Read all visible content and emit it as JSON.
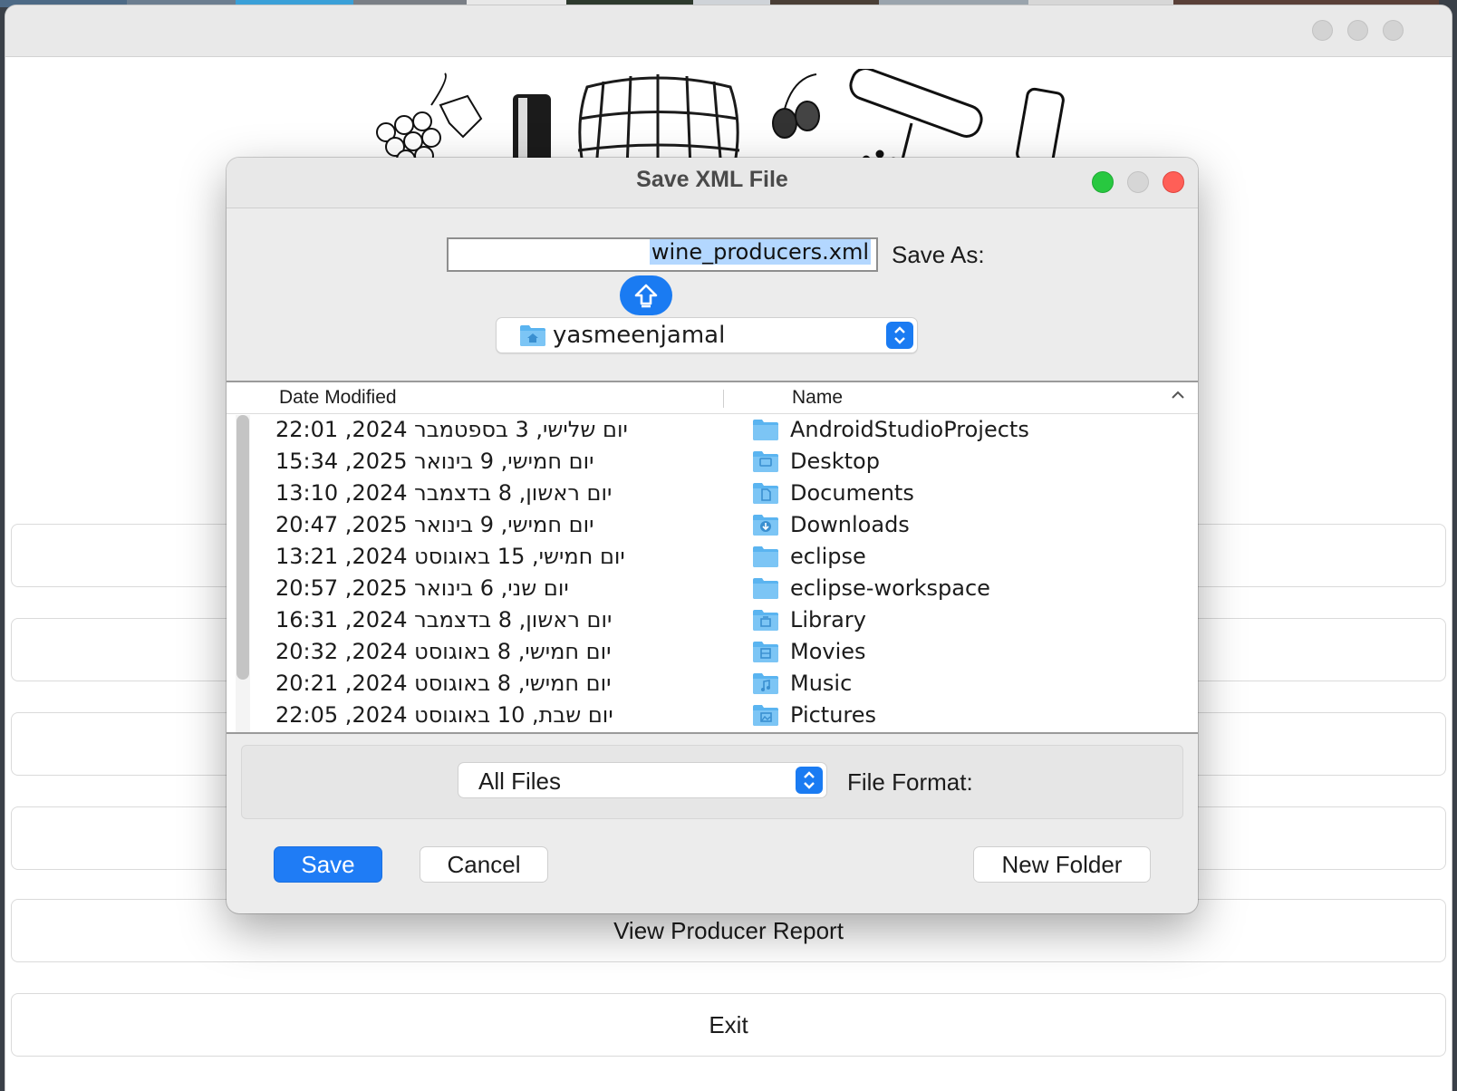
{
  "dialog": {
    "title": "Save XML File",
    "save_as_label": "Save As:",
    "filename_value": "wine_producers.xml",
    "location": "yasmeenjamal",
    "columns": {
      "date": "Date Modified",
      "name": "Name"
    },
    "files": [
      {
        "date": "יום שלישי, 3 בספטמבר 2024, 22:01",
        "name": "AndroidStudioProjects",
        "icon": "folder-icon"
      },
      {
        "date": "יום חמישי, 9 בינואר 2025, 15:34",
        "name": "Desktop",
        "icon": "desktop-folder-icon"
      },
      {
        "date": "יום ראשון, 8 בדצמבר 2024, 13:10",
        "name": "Documents",
        "icon": "documents-folder-icon"
      },
      {
        "date": "יום חמישי, 9 בינואר 2025, 20:47",
        "name": "Downloads",
        "icon": "downloads-folder-icon"
      },
      {
        "date": "יום חמישי, 15 באוגוסט 2024, 13:21",
        "name": "eclipse",
        "icon": "folder-icon"
      },
      {
        "date": "יום שני, 6 בינואר 2025, 20:57",
        "name": "eclipse-workspace",
        "icon": "folder-icon"
      },
      {
        "date": "יום ראשון, 8 בדצמבר 2024, 16:31",
        "name": "Library",
        "icon": "library-folder-icon"
      },
      {
        "date": "יום חמישי, 8 באוגוסט 2024, 20:32",
        "name": "Movies",
        "icon": "movies-folder-icon"
      },
      {
        "date": "יום חמישי, 8 באוגוסט 2024, 20:21",
        "name": "Music",
        "icon": "music-folder-icon"
      },
      {
        "date": "יום שבת, 10 באוגוסט 2024, 22:05",
        "name": "Pictures",
        "icon": "pictures-folder-icon"
      }
    ],
    "file_format_label": "File Format:",
    "file_format_value": "All Files",
    "buttons": {
      "save": "Save",
      "cancel": "Cancel",
      "new_folder": "New Folder"
    }
  },
  "main_window": {
    "buttons": [
      "View Producer Report",
      "Exit"
    ]
  },
  "colors": {
    "accent": "#1f7cf5",
    "close": "#ff5f57",
    "zoom": "#28c840",
    "folder": "#5ab4f0"
  }
}
